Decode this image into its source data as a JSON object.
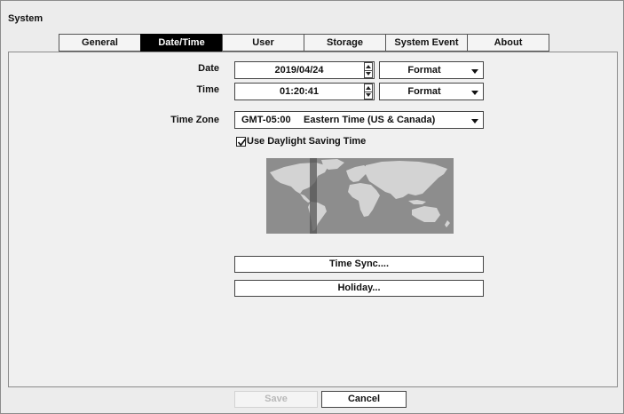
{
  "window": {
    "title": "System"
  },
  "tabs": [
    {
      "label": "General",
      "active": false
    },
    {
      "label": "Date/Time",
      "active": true
    },
    {
      "label": "User",
      "active": false
    },
    {
      "label": "Storage",
      "active": false
    },
    {
      "label": "System Event",
      "active": false
    },
    {
      "label": "About",
      "active": false
    }
  ],
  "date": {
    "label": "Date",
    "value": "2019/04/24",
    "format_label": "Format"
  },
  "time": {
    "label": "Time",
    "value": "01:20:41",
    "format_label": "Format"
  },
  "timezone": {
    "label": "Time Zone",
    "offset": "GMT-05:00",
    "name": "Eastern Time (US & Canada)"
  },
  "dst": {
    "label": "Use Daylight Saving Time",
    "checked": true
  },
  "buttons": {
    "time_sync": "Time Sync....",
    "holiday": "Holiday...",
    "save": "Save",
    "cancel": "Cancel"
  },
  "colors": {
    "active_tab": "#000000",
    "map_ocean": "#8d8d8d",
    "map_land": "#d3d3d3",
    "tz_band": "#555555"
  }
}
